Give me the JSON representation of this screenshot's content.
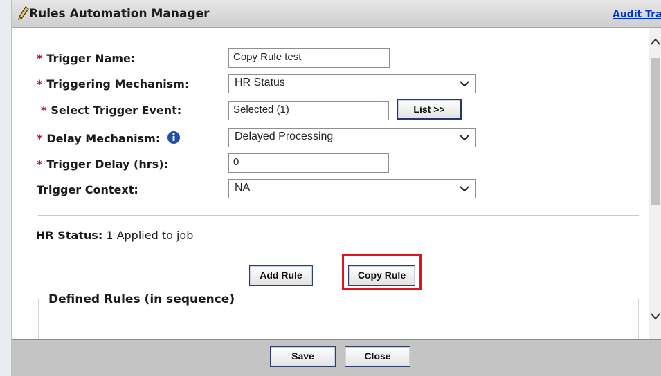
{
  "window": {
    "title": "Rules Automation Manager",
    "audit_link": "Audit Trail"
  },
  "form": {
    "trigger_name": {
      "label": "Trigger Name:",
      "required_mark": "*",
      "value": "Copy Rule test"
    },
    "triggering_mechanism": {
      "label": "Triggering Mechanism:",
      "required_mark": "*",
      "value": "HR Status"
    },
    "select_trigger_event": {
      "label": "Select Trigger Event:",
      "required_mark": "*",
      "value": "Selected (1)",
      "button_label": "List >>"
    },
    "delay_mechanism": {
      "label": "Delay Mechanism:",
      "required_mark": "*",
      "value": "Delayed Processing"
    },
    "trigger_delay": {
      "label": "Trigger Delay (hrs):",
      "required_mark": "*",
      "value": "0"
    },
    "trigger_context": {
      "label": "Trigger Context:",
      "value": "NA"
    }
  },
  "hr_status": {
    "label": "HR Status:",
    "value": "1 Applied to job"
  },
  "rules": {
    "add_button": "Add Rule",
    "copy_button": "Copy Rule",
    "defined_rules_legend": "Defined Rules (in sequence)"
  },
  "footer": {
    "save_button": "Save",
    "close_button": "Close"
  },
  "colors": {
    "required": "#d0021b",
    "highlight": "#e0141e",
    "link": "#0033cc",
    "info_icon": "#1f4fa8"
  },
  "icons": {
    "title": "pencil-icon",
    "info": "info-icon",
    "dropdown": "chevron-down-icon"
  }
}
